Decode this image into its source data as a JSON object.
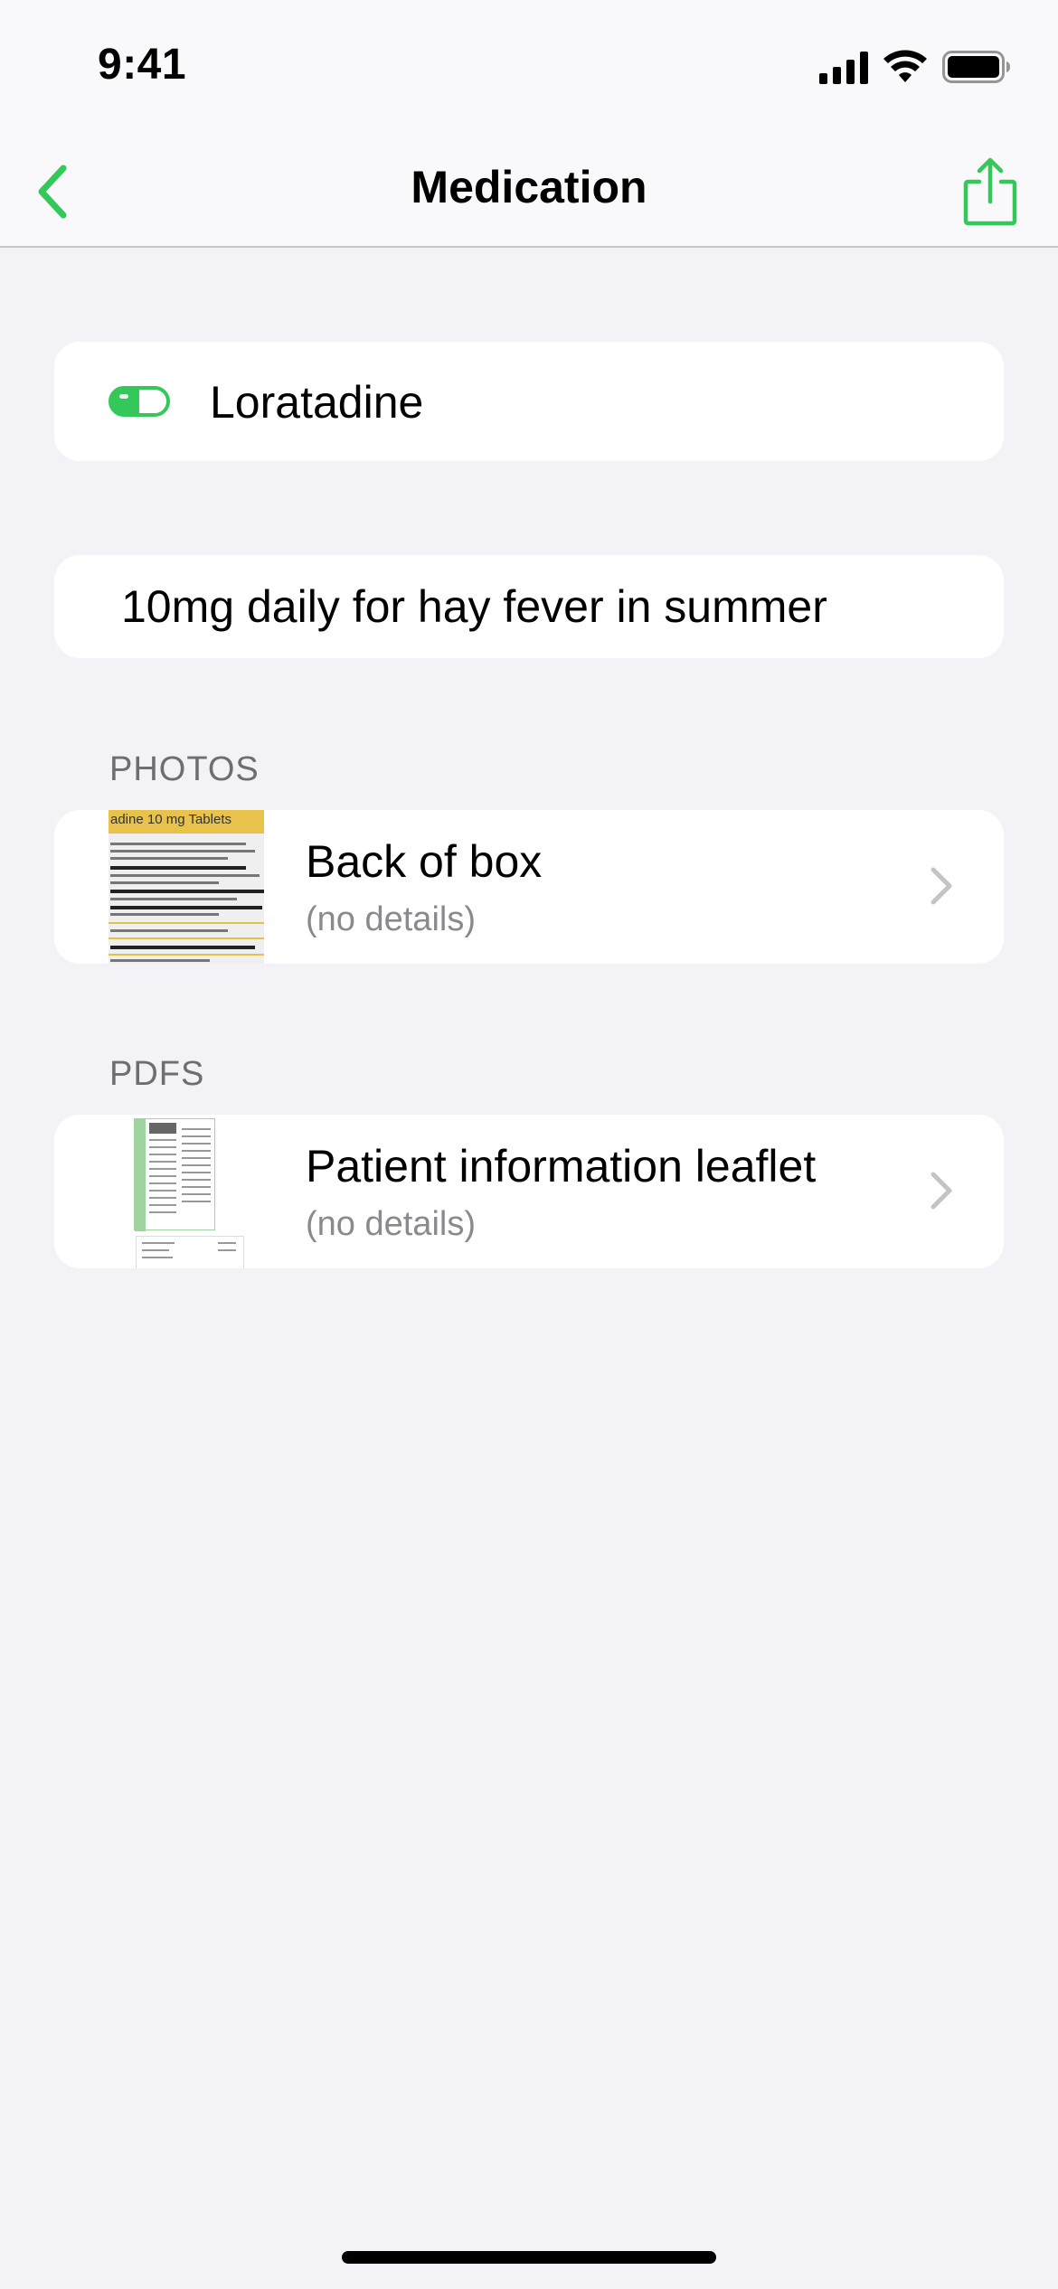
{
  "status_bar": {
    "time": "9:41"
  },
  "nav": {
    "title": "Medication"
  },
  "medication": {
    "name": "Loratadine",
    "notes": "10mg daily for hay fever in summer"
  },
  "photos": {
    "header": "PHOTOS",
    "items": [
      {
        "title": "Back of box",
        "subtitle": "(no details)",
        "thumbnail_label": "adine 10 mg Tablets",
        "thumbnail_lines": [
          "ind contains 10 mg of loratadine. Also contains lactose",
          "le the symptoms of hay fever and other allergies e.g. wet or itchy",
          "er and children over 12 years of age:",
          "s aged 2 - 12 years of age, weighing more than 30 kg",
          "O NOT EXCEED THE STATED DOSE",
          "UT OF THE REACH AND SIGHT OF CHILDREN"
        ]
      }
    ]
  },
  "pdfs": {
    "header": "PDFS",
    "items": [
      {
        "title": "Patient information leaflet",
        "subtitle": "(no details)"
      }
    ]
  },
  "colors": {
    "accent": "#34c759",
    "background": "#f2f2f7",
    "card": "#ffffff",
    "secondary_text": "#8a8a8e",
    "section_header": "#6d6d72"
  },
  "icons": {
    "back": "chevron-left-icon",
    "share": "share-icon",
    "pill": "pill-icon",
    "disclosure": "chevron-right-icon"
  }
}
